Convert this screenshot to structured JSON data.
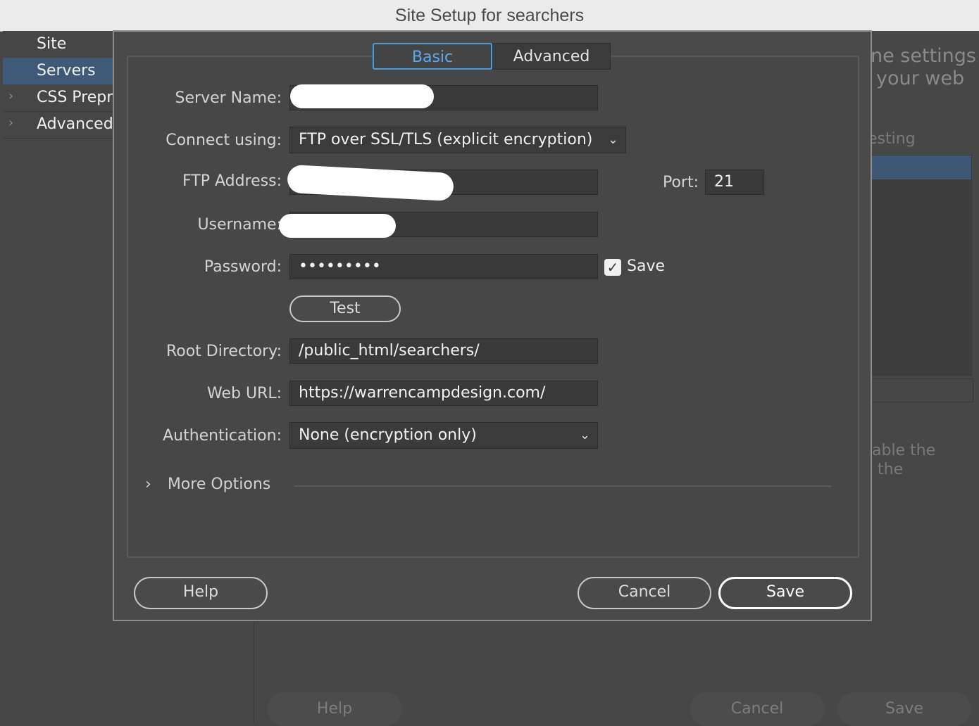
{
  "window": {
    "title": "Site Setup for searchers"
  },
  "sidebar": {
    "items": [
      {
        "label": "Site",
        "selected": false,
        "expandable": false
      },
      {
        "label": "Servers",
        "selected": true,
        "expandable": false
      },
      {
        "label": "CSS Preprc",
        "selected": false,
        "expandable": true
      },
      {
        "label": "Advanced",
        "selected": false,
        "expandable": true
      }
    ]
  },
  "background": {
    "description_lines": [
      "ne settings",
      "your web"
    ],
    "tab_fragment": "esting",
    "note_lines": [
      "able the",
      "the"
    ],
    "buttons": {
      "help": "Help",
      "cancel": "Cancel",
      "save": "Save"
    }
  },
  "dialog": {
    "tabs": [
      {
        "label": "Basic",
        "active": true
      },
      {
        "label": "Advanced",
        "active": false
      }
    ],
    "fields": {
      "server_name": {
        "label": "Server Name:",
        "value": ""
      },
      "connect_using": {
        "label": "Connect using:",
        "value": "FTP over SSL/TLS (explicit encryption)"
      },
      "ftp_address": {
        "label": "FTP Address:",
        "value": ""
      },
      "port": {
        "label": "Port:",
        "value": "21"
      },
      "username": {
        "label": "Username:",
        "value": ""
      },
      "password": {
        "label": "Password:",
        "value": "•••••••••"
      },
      "save_password": {
        "label": "Save",
        "checked": true
      },
      "root_directory": {
        "label": "Root Directory:",
        "value": "/public_html/searchers/"
      },
      "web_url": {
        "label": "Web URL:",
        "value": "https://warrencampdesign.com/"
      },
      "authentication": {
        "label": "Authentication:",
        "value": "None (encryption only)"
      }
    },
    "test_label": "Test",
    "more_options_label": "More Options",
    "buttons": {
      "help": "Help",
      "cancel": "Cancel",
      "save": "Save"
    }
  },
  "colors": {
    "accent": "#4b9be0",
    "selection": "#3f5a78",
    "background": "#464646"
  }
}
